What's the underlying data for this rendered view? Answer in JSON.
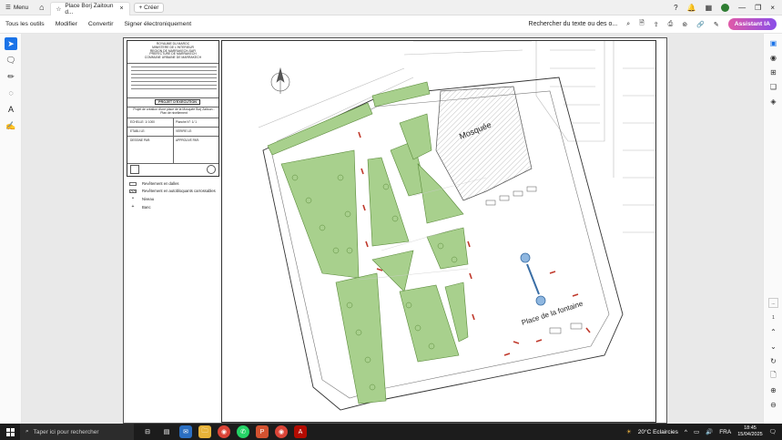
{
  "browser": {
    "menu_label": "Menu",
    "tab_title": "Place Borj Zaitoun d...",
    "new_tab_label": "Créer"
  },
  "toolbar": {
    "items": [
      "Tous les outils",
      "Modifier",
      "Convertir",
      "Signer électroniquement"
    ],
    "search_placeholder": "Rechercher du texte ou des o...",
    "ai_label": "Assistant IA"
  },
  "document": {
    "org_lines": [
      "ROYAUME DU MAROC",
      "MINISTERE DE L'INTERIEUR",
      "REGION DE MARRAKECH-SAFI",
      "PREFECTURE DE MARRAKECH",
      "COMMUNE URBAINE DE MARRAKECH"
    ],
    "project_label": "PROJET D'EXECUTION",
    "plan_title": "Projet de création d'une place de la Mosquée Borj Zaitoun - Plan de nivellement",
    "scale_label": "ECHELLE: 1/ 1000",
    "planche_label": "Planche N°: 1/ 1",
    "date_label": "ETABLI LE:",
    "verified_label": "VERIFIE LE:",
    "drawn_label": "DESSINE PAR:",
    "approved_label": "APPROUVE PAR:",
    "legend": [
      {
        "label": "Revêtement en dalles",
        "style": "plain"
      },
      {
        "label": "Revêtement en autobloquants carrossables",
        "style": "hatch"
      },
      {
        "label": "Niveau",
        "style": "dot"
      },
      {
        "label": "Banc",
        "style": "cross"
      }
    ],
    "label_mosque": "Mosquée",
    "label_place": "Place de la fontaine"
  },
  "rightbar": {
    "page_current": "...",
    "page_total": "1"
  },
  "taskbar": {
    "search_placeholder": "Taper ici pour rechercher",
    "weather": "20°C  Eclaircies",
    "language": "FRA",
    "time": "18:45",
    "date": "15/04/2025"
  },
  "colors": {
    "green_area": "#a8d08d",
    "ai_start": "#e05aa8",
    "ai_end": "#8a4de8",
    "accent": "#1a73e8"
  }
}
